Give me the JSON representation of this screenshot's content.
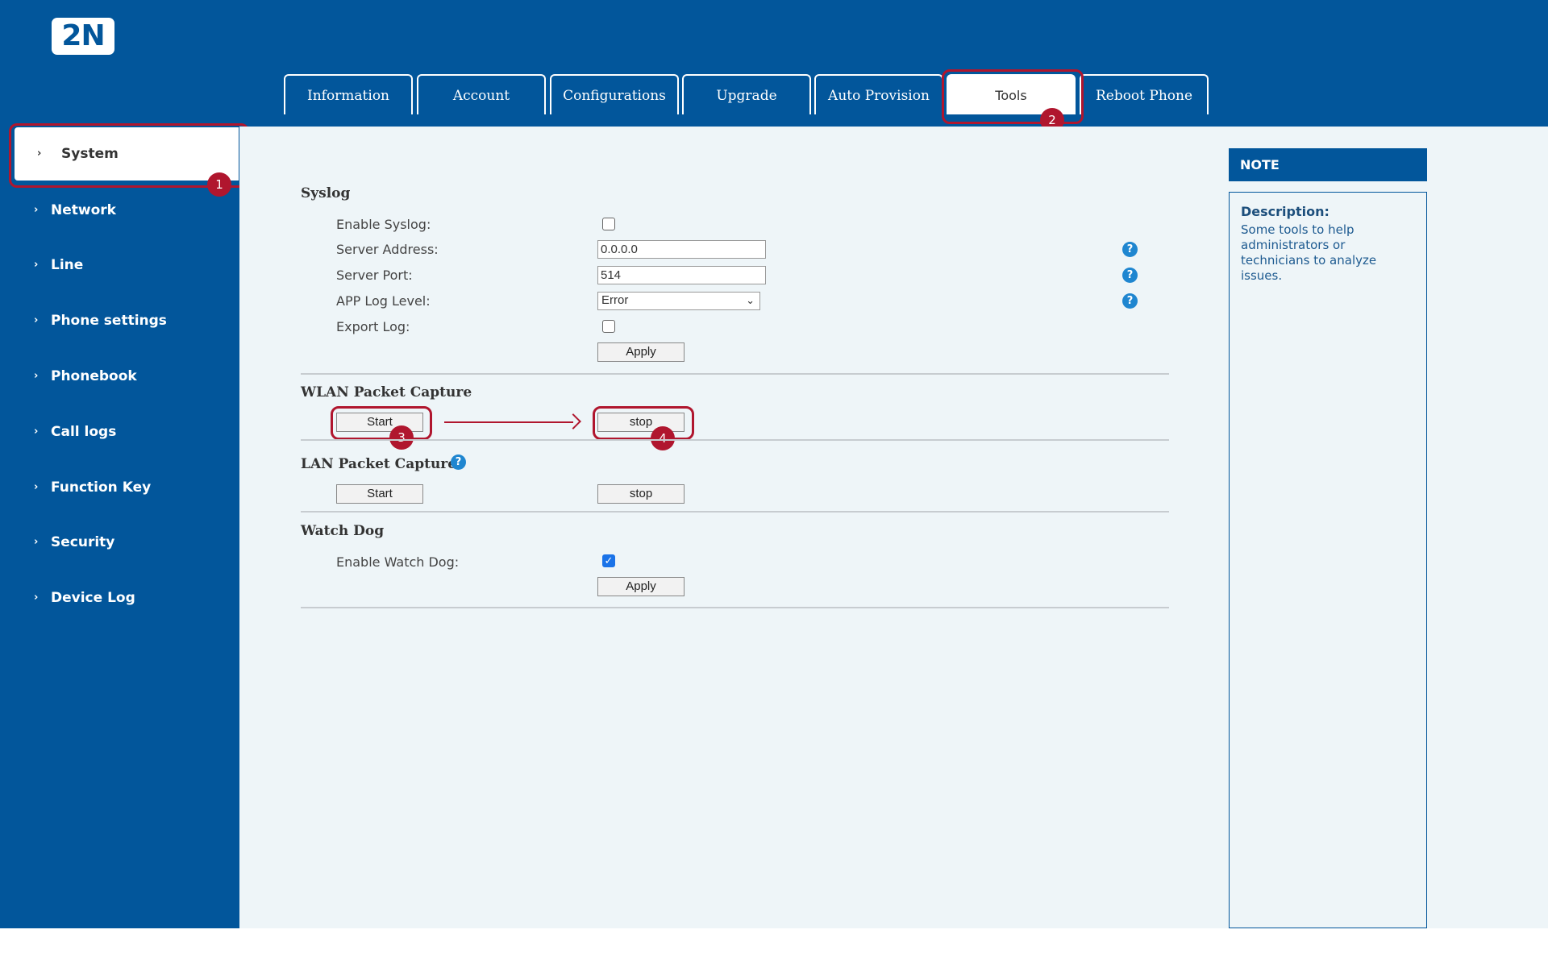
{
  "logo": {
    "text": "2N"
  },
  "sidebar": {
    "items": [
      {
        "label": "System"
      },
      {
        "label": "Network"
      },
      {
        "label": "Line"
      },
      {
        "label": "Phone settings"
      },
      {
        "label": "Phonebook"
      },
      {
        "label": "Call logs"
      },
      {
        "label": "Function Key"
      },
      {
        "label": "Security"
      },
      {
        "label": "Device Log"
      }
    ],
    "chevron": "›"
  },
  "tabs": [
    {
      "label": "Information"
    },
    {
      "label": "Account"
    },
    {
      "label": "Configurations"
    },
    {
      "label": "Upgrade"
    },
    {
      "label": "Auto Provision"
    },
    {
      "label": "Tools"
    },
    {
      "label": "Reboot Phone"
    }
  ],
  "annotations": {
    "b1": "1",
    "b2": "2",
    "b3": "3",
    "b4": "4"
  },
  "syslog": {
    "title": "Syslog",
    "enable_label": "Enable Syslog:",
    "enable_checked": false,
    "server_address_label": "Server Address:",
    "server_address": "0.0.0.0",
    "server_port_label": "Server Port:",
    "server_port": "514",
    "log_level_label": "APP Log Level:",
    "log_level": "Error",
    "export_label": "Export Log:",
    "export_checked": false,
    "apply": "Apply"
  },
  "wlan": {
    "title": "WLAN Packet Capture",
    "start": "Start",
    "stop": "stop"
  },
  "lan": {
    "title": "LAN Packet Capture",
    "start": "Start",
    "stop": "stop"
  },
  "watchdog": {
    "title": "Watch Dog",
    "enable_label": "Enable Watch Dog:",
    "enable_checked": true,
    "apply": "Apply"
  },
  "help_icon": "?",
  "check_mark": "✓",
  "caret": "⌄",
  "note": {
    "header": "NOTE",
    "title": "Description:",
    "text": "Some tools to help administrators or technicians to analyze issues."
  }
}
